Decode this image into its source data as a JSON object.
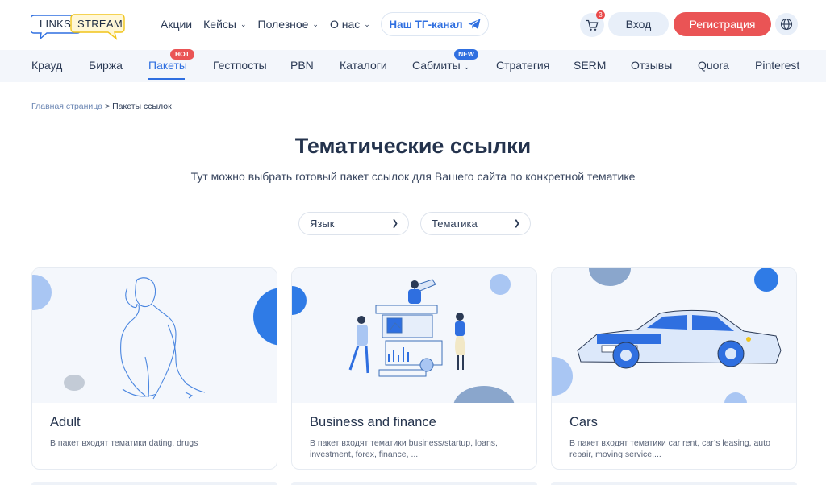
{
  "header": {
    "logo": {
      "word1": "LINKS",
      "word2": "STREAM"
    },
    "nav": [
      {
        "label": "Акции",
        "has_dropdown": false
      },
      {
        "label": "Кейсы",
        "has_dropdown": true
      },
      {
        "label": "Полезное",
        "has_dropdown": true
      },
      {
        "label": "О нас",
        "has_dropdown": true
      }
    ],
    "tg_button": "Наш ТГ-канал",
    "cart_count": "3",
    "login": "Вход",
    "register": "Регистрация",
    "accent_color": "#2f6fe0",
    "register_color": "#ea5455"
  },
  "subnav": {
    "items": [
      {
        "label": "Крауд"
      },
      {
        "label": "Биржа"
      },
      {
        "label": "Пакеты",
        "badge": "HOT",
        "active": true
      },
      {
        "label": "Гестпосты"
      },
      {
        "label": "PBN"
      },
      {
        "label": "Каталоги"
      },
      {
        "label": "Сабмиты",
        "badge": "NEW",
        "has_dropdown": true
      },
      {
        "label": "Стратегия"
      },
      {
        "label": "SERM"
      },
      {
        "label": "Отзывы"
      },
      {
        "label": "Quora"
      },
      {
        "label": "Pinterest"
      }
    ]
  },
  "breadcrumb": {
    "home": "Главная страница",
    "separator": ">",
    "current": "Пакеты ссылок"
  },
  "page": {
    "title": "Тематические ссылки",
    "subtitle": "Тут можно выбрать готовый пакет ссылок для Вашего сайта по конкретной тематике"
  },
  "filters": {
    "language": "Язык",
    "theme": "Тематика"
  },
  "cards": [
    {
      "title": "Adult",
      "desc": "В пакет входят тематики dating, drugs"
    },
    {
      "title": "Business and finance",
      "desc": "В пакет входят тематики business/startup, loans, investment, forex, finance, ..."
    },
    {
      "title": "Cars",
      "desc": "В пакет входят тематики car rent, car’s leasing, auto repair, moving service,..."
    }
  ]
}
